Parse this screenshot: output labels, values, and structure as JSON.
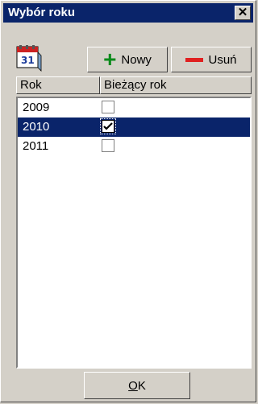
{
  "window": {
    "title": "Wybór roku",
    "close_glyph": "✕"
  },
  "toolbar": {
    "new_label": "Nowy",
    "delete_label": "Usuń",
    "calendar_icon": "calendar-icon"
  },
  "table": {
    "columns": [
      "Rok",
      "Bieżący rok"
    ],
    "rows": [
      {
        "year": "2009",
        "current": false,
        "selected": false
      },
      {
        "year": "2010",
        "current": true,
        "selected": true
      },
      {
        "year": "2011",
        "current": false,
        "selected": false
      }
    ]
  },
  "footer": {
    "ok_label_underlined": "O",
    "ok_label_rest": "K"
  },
  "colors": {
    "title_bg": "#0a246a",
    "selection_bg": "#0a246a",
    "plus": "#0a8a1a",
    "minus": "#e02020"
  }
}
